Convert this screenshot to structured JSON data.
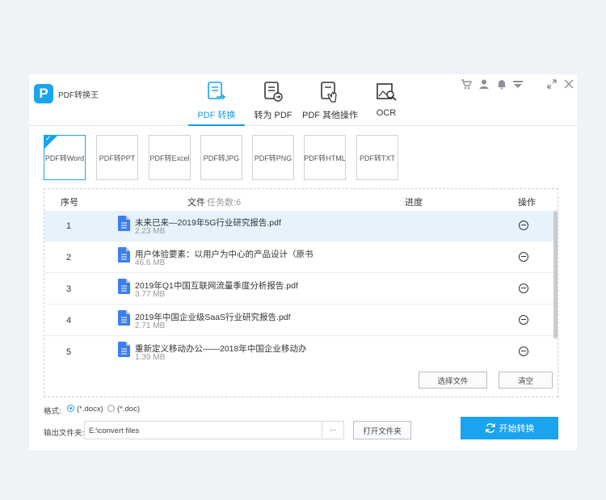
{
  "app": {
    "logo_letter": "P",
    "name": "PDF转换王",
    "accent": "#1aa3ee"
  },
  "tabs": [
    {
      "label": "PDF 转换",
      "icon": "pdf-convert-icon",
      "active": true
    },
    {
      "label": "转为 PDF",
      "icon": "to-pdf-icon",
      "active": false
    },
    {
      "label": "PDF 其他操作",
      "icon": "pdf-tools-icon",
      "active": false
    },
    {
      "label": "OCR",
      "icon": "ocr-icon",
      "active": false
    }
  ],
  "window_controls": [
    "cart-icon",
    "user-icon",
    "bell-icon",
    "menu-icon",
    "minimize-icon",
    "close-icon"
  ],
  "subtypes": [
    "PDF转Word",
    "PDF转PPT",
    "PDF转Excel",
    "PDF转JPG",
    "PDF转PNG",
    "PDF转HTML",
    "PDF转TXT"
  ],
  "table": {
    "headers": {
      "index": "序号",
      "file": "文件",
      "task_count": "任务数:6",
      "progress": "进度",
      "action": "操作"
    },
    "rows": [
      {
        "index": "1",
        "name": "未来已来—2019年5G行业研究报告.pdf",
        "size": "2.23 MB"
      },
      {
        "index": "2",
        "name": "用户体验要素：以用户为中心的产品设计（原书",
        "size": "46.6 MB"
      },
      {
        "index": "3",
        "name": "2019年Q1中国互联网流量季度分析报告.pdf",
        "size": "3.77 MB"
      },
      {
        "index": "4",
        "name": "2019年中国企业级SaaS行业研究报告.pdf",
        "size": "2.71 MB"
      },
      {
        "index": "5",
        "name": "重新定义移动办公——2018年中国企业移动办",
        "size": "1.39 MB"
      }
    ]
  },
  "buttons": {
    "select_files": "选择文件",
    "clear": "清空",
    "open_folder": "打开文件夹",
    "browse": "...",
    "start": "开始转换"
  },
  "format": {
    "label": "格式:",
    "option_docx": "(*.docx)",
    "option_doc": "(*.doc)",
    "selected": "docx"
  },
  "output": {
    "label": "输出文件夹:",
    "path": "E:\\convert files"
  }
}
